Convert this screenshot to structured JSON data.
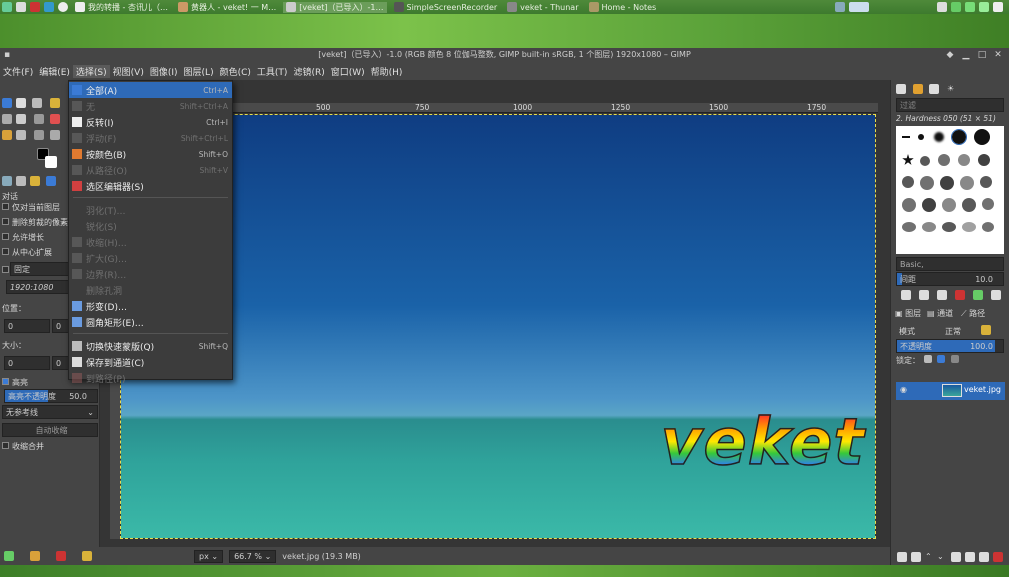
{
  "taskbar": {
    "tasks": [
      {
        "label": "我的转播 - 杏讯儿（…",
        "active": false
      },
      {
        "label": "黄器人 - veket! 一 M…",
        "active": false
      },
      {
        "label": "[veket]（已导入）-1…",
        "active": true
      },
      {
        "label": "SimpleScreenRecorder",
        "active": false
      },
      {
        "label": "veket - Thunar",
        "active": false
      },
      {
        "label": "Home - Notes",
        "active": false
      }
    ]
  },
  "window": {
    "title": "[veket]（已导入）-1.0 (RGB 颜色 8 位伽马整数, GIMP built-in sRGB, 1 个图层) 1920x1080 – GIMP"
  },
  "menubar": [
    "文件(F)",
    "编辑(E)",
    "选择(S)",
    "视图(V)",
    "图像(I)",
    "图层(L)",
    "颜色(C)",
    "工具(T)",
    "滤镜(R)",
    "窗口(W)",
    "帮助(H)"
  ],
  "select_menu": [
    {
      "label": "全部(A)",
      "shortcut": "Ctrl+A",
      "enabled": true,
      "icon": "select-all-icon",
      "group": 0
    },
    {
      "label": "无",
      "shortcut": "Shift+Ctrl+A",
      "enabled": false,
      "icon": "select-none-icon",
      "group": 0
    },
    {
      "label": "反转(I)",
      "shortcut": "Ctrl+I",
      "enabled": true,
      "icon": "invert-icon",
      "group": 0
    },
    {
      "label": "浮动(F)",
      "shortcut": "Shift+Ctrl+L",
      "enabled": false,
      "icon": "float-icon",
      "group": 0
    },
    {
      "label": "按颜色(B)",
      "shortcut": "Shift+O",
      "enabled": true,
      "icon": "by-color-icon",
      "group": 0
    },
    {
      "label": "从路径(O)",
      "shortcut": "Shift+V",
      "enabled": false,
      "icon": "from-path-icon",
      "group": 0
    },
    {
      "label": "选区编辑器(S)",
      "shortcut": "",
      "enabled": true,
      "icon": "selection-editor-icon",
      "group": 0
    },
    {
      "label": "羽化(T)…",
      "shortcut": "",
      "enabled": false,
      "icon": "",
      "group": 1
    },
    {
      "label": "锐化(S)",
      "shortcut": "",
      "enabled": false,
      "icon": "",
      "group": 1
    },
    {
      "label": "收缩(H)…",
      "shortcut": "",
      "enabled": false,
      "icon": "shrink-icon",
      "group": 1
    },
    {
      "label": "扩大(G)…",
      "shortcut": "",
      "enabled": false,
      "icon": "grow-icon",
      "group": 1
    },
    {
      "label": "边界(R)…",
      "shortcut": "",
      "enabled": false,
      "icon": "border-icon",
      "group": 1
    },
    {
      "label": "删除孔洞",
      "shortcut": "",
      "enabled": false,
      "icon": "",
      "group": 1
    },
    {
      "label": "形变(D)…",
      "shortcut": "",
      "enabled": true,
      "icon": "distort-icon",
      "group": 1
    },
    {
      "label": "圆角矩形(E)…",
      "shortcut": "",
      "enabled": true,
      "icon": "rounded-rect-icon",
      "group": 1
    },
    {
      "label": "切换快速蒙版(Q)",
      "shortcut": "Shift+Q",
      "enabled": true,
      "icon": "quick-mask-icon",
      "group": 2
    },
    {
      "label": "保存到通道(C)",
      "shortcut": "",
      "enabled": true,
      "icon": "save-channel-icon",
      "group": 2
    },
    {
      "label": "到路径(P)",
      "shortcut": "",
      "enabled": false,
      "icon": "to-path-icon",
      "group": 2
    }
  ],
  "tool_options": {
    "section": "对话",
    "opt_current_layer": "仅对当前图层",
    "opt_delete_cut": "删除剪裁的像素",
    "opt_allow_grow": "允许增长",
    "opt_from_center": "从中心扩展",
    "fixed_label": "固定",
    "fixed_value": "1920:1080",
    "position_label": "位置：",
    "pos_x": "0",
    "pos_y": "0",
    "size_label": "大小：",
    "size_x": "0",
    "size_y": "0",
    "highlight_label": "高亮",
    "highlight_opacity_label": "高亮不透明度",
    "highlight_opacity_value": "50.0",
    "guides_value": "无参考线",
    "auto_shrink": "自动收缩",
    "shrink_merged": "收缩合并"
  },
  "ruler": [
    "500",
    "750",
    "1000",
    "1250",
    "1500",
    "1750"
  ],
  "canvas": {
    "overlay_text": "veket",
    "colors": {
      "sky_top": "#0f3d82",
      "sea": "#2fa39b"
    }
  },
  "statusbar": {
    "unit": "px",
    "zoom": "66.7 %",
    "file_info": "veket.jpg (19.3 MB)"
  },
  "dock": {
    "filter_placeholder": "过滤",
    "brush_name": "2. Hardness 050 (51 × 51)",
    "preset": "Basic,",
    "spacing_label": "间距",
    "spacing_value": "10.0",
    "tabs": [
      "图层",
      "通道",
      "路径"
    ],
    "mode_label": "模式",
    "mode_value": "正常",
    "opacity_label": "不透明度",
    "opacity_value": "100.0",
    "lock_label": "锁定：",
    "layer_name": "veket.jpg"
  }
}
